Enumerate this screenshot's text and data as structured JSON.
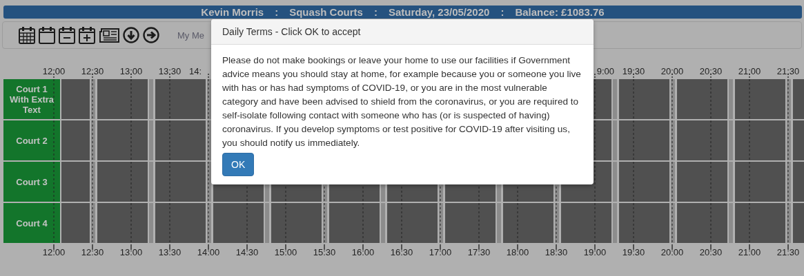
{
  "header": {
    "items": [
      "Kevin Morris",
      "Squash Courts",
      "Saturday, 23/05/2020",
      "Balance: £1083.76"
    ],
    "separator": ":"
  },
  "toolbar": {
    "tools": [
      {
        "kind": "calendar-grid"
      },
      {
        "kind": "calendar"
      },
      {
        "kind": "calendar-minus"
      },
      {
        "kind": "calendar-plus"
      },
      {
        "kind": "newspaper"
      },
      {
        "kind": "arrow-down"
      },
      {
        "kind": "arrow-right"
      }
    ],
    "menu_label": "My Me"
  },
  "top_axis": {
    "left": [
      "12:00",
      "12:30",
      "13:00",
      "13:30",
      "14:"
    ],
    "right": [
      "9:00",
      "19:30",
      "20:00",
      "20:30",
      "21:00",
      "21:30"
    ]
  },
  "courts": [
    {
      "name": "Court 1 With Extra Text"
    },
    {
      "name": "Court 2"
    },
    {
      "name": "Court 3"
    },
    {
      "name": "Court 4"
    }
  ],
  "bottom_axis": [
    "12:00",
    "12:30",
    "13:00",
    "13:30",
    "14:00",
    "14:30",
    "15:00",
    "15:30",
    "16:00",
    "16:30",
    "17:00",
    "17:30",
    "18:00",
    "18:30",
    "19:00",
    "19:30",
    "20:00",
    "20:30",
    "21:00",
    "21:30"
  ],
  "dialog": {
    "title": "Daily Terms - Click OK to accept",
    "body": "Please do not make bookings or leave your home to use our facilities if Government advice means you should stay at home, for example because you or someone you live with has or has had symptoms of COVID-19, or you are in the most vulnerable category and have been advised to shield from the coronavirus, or you are required to self-isolate following contact with someone who has (or is suspected of having) coronavirus. If you develop symptoms or test positive for COVID-19 after visiting us, you should notify us immediately.",
    "button": "OK"
  }
}
